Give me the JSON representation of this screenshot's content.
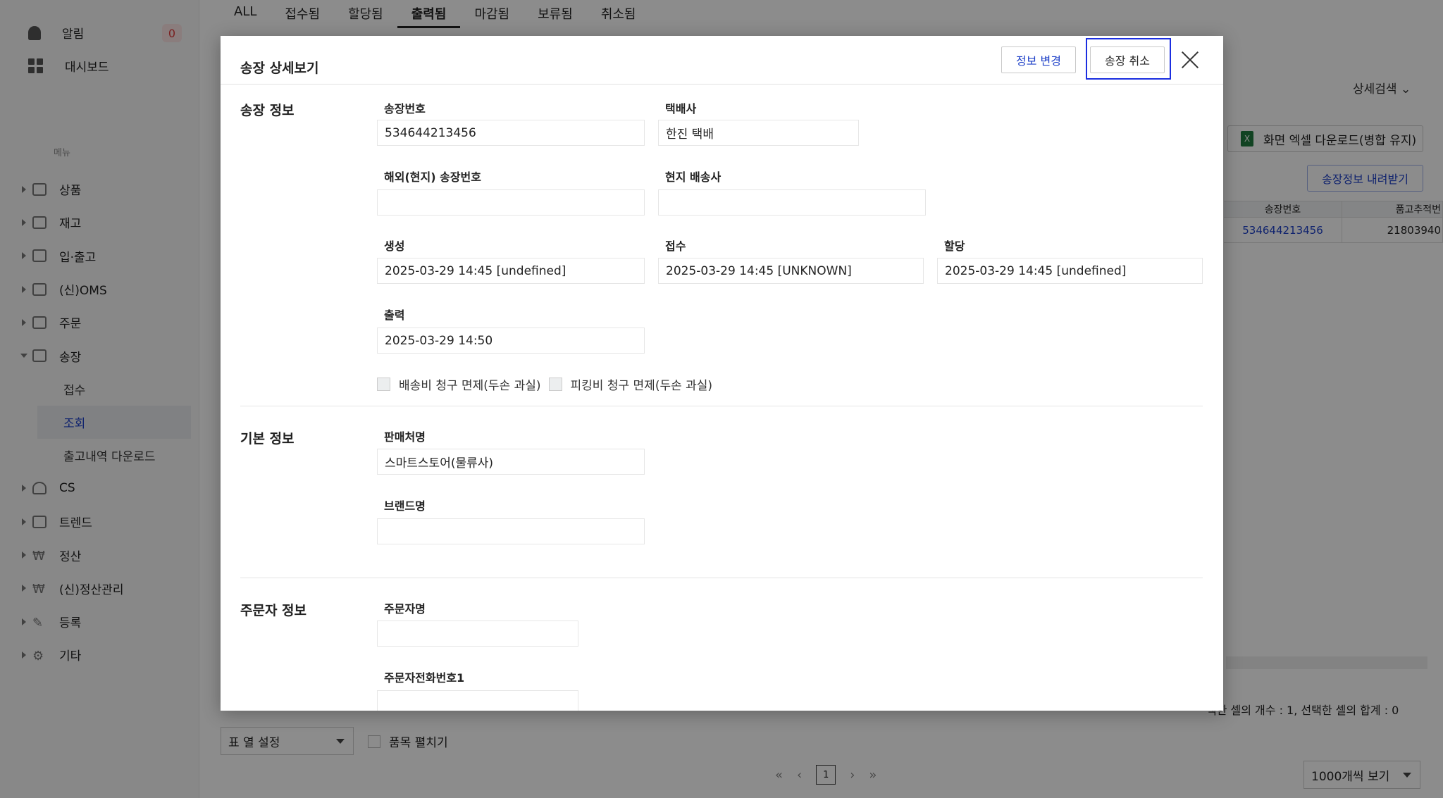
{
  "sidebar": {
    "alarm_label": "알림",
    "alarm_count": "0",
    "dashboard_label": "대시보드",
    "menu_header": "메뉴",
    "items": [
      {
        "label": "상품"
      },
      {
        "label": "재고"
      },
      {
        "label": "입·출고"
      },
      {
        "label": "(신)OMS"
      },
      {
        "label": "주문"
      },
      {
        "label": "송장"
      }
    ],
    "sub_items": [
      {
        "label": "접수"
      },
      {
        "label": "조회"
      },
      {
        "label": "출고내역 다운로드"
      }
    ],
    "items_after": [
      {
        "label": "CS"
      },
      {
        "label": "트렌드"
      },
      {
        "label": "정산"
      },
      {
        "label": "(신)정산관리"
      },
      {
        "label": "등록"
      },
      {
        "label": "기타"
      }
    ]
  },
  "tabs": [
    "ALL",
    "접수됨",
    "할당됨",
    "출력됨",
    "마감됨",
    "보류됨",
    "취소됨"
  ],
  "toolbar": {
    "detail_search": "상세검색",
    "excel_download": "화면 엑셀 다운로드(병합 유지)",
    "excel_icon": "X",
    "invoice_download": "송장정보 내려받기"
  },
  "grid": {
    "headers": [
      "송장번호",
      "품고추적번"
    ],
    "row": [
      "534644213456",
      "21803940"
    ]
  },
  "footer": {
    "cell_stats": "택한 셀의 개수 : 1, 선택한 셀의 합계 : 0",
    "column_setting": "표 열 설정",
    "expand_items": "품목 펼치기",
    "page_first": "«",
    "page_prev": "‹",
    "current_page": "1",
    "page_next": "›",
    "page_last": "»",
    "per_page": "1000개씩 보기"
  },
  "modal": {
    "title": "송장 상세보기",
    "edit_button": "정보 변경",
    "cancel_button": "송장 취소",
    "invoice_section": {
      "title": "송장 정보",
      "invoice_no_label": "송장번호",
      "invoice_no": "534644213456",
      "carrier_label": "택배사",
      "carrier": "한진 택배",
      "overseas_no_label": "해외(현지) 송장번호",
      "overseas_no": "",
      "local_carrier_label": "현지 배송사",
      "local_carrier": "",
      "created_label": "생성",
      "created": "2025-03-29 14:45 [undefined]",
      "received_label": "접수",
      "received": "2025-03-29 14:45 [UNKNOWN]",
      "assigned_label": "할당",
      "assigned": "2025-03-29 14:45 [undefined]",
      "printed_label": "출력",
      "printed": "2025-03-29 14:50",
      "waive_shipping_label": "배송비 청구 면제(두손 과실)",
      "waive_picking_label": "피킹비 청구 면제(두손 과실)"
    },
    "basic_section": {
      "title": "기본 정보",
      "seller_label": "판매처명",
      "seller": "스마트스토어(물류사)",
      "brand_label": "브랜드명",
      "brand": ""
    },
    "orderer_section": {
      "title": "주문자 정보",
      "name_label": "주문자명",
      "name": "",
      "phone1_label": "주문자전화번호1",
      "phone1": ""
    }
  }
}
